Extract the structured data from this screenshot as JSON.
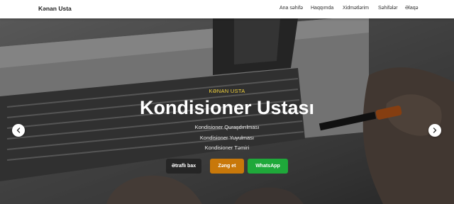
{
  "navbar": {
    "brand": "Kənan Usta",
    "links": [
      "Ana səhifə",
      "Haqqımda",
      "Xidmətlərim",
      "Səhifələr",
      "Əlaqə"
    ]
  },
  "hero": {
    "eyebrow": "KƏNAN USTA",
    "title": "Kondisioner Ustası",
    "services": [
      "Kondisioner Quraşdırılması",
      "Kondisioner Yuyulması",
      "Kondisioner Təmiri"
    ],
    "buttons": {
      "more": "Ətraflı bax",
      "call": "Zəng et",
      "whatsapp": "WhatsApp"
    }
  },
  "carousel": {
    "prev_icon": "chevron-left-icon",
    "next_icon": "chevron-right-icon"
  },
  "colors": {
    "eyebrow": "#f2d23c",
    "call_button": "#c8780a",
    "whatsapp_button": "#1fa83a"
  }
}
